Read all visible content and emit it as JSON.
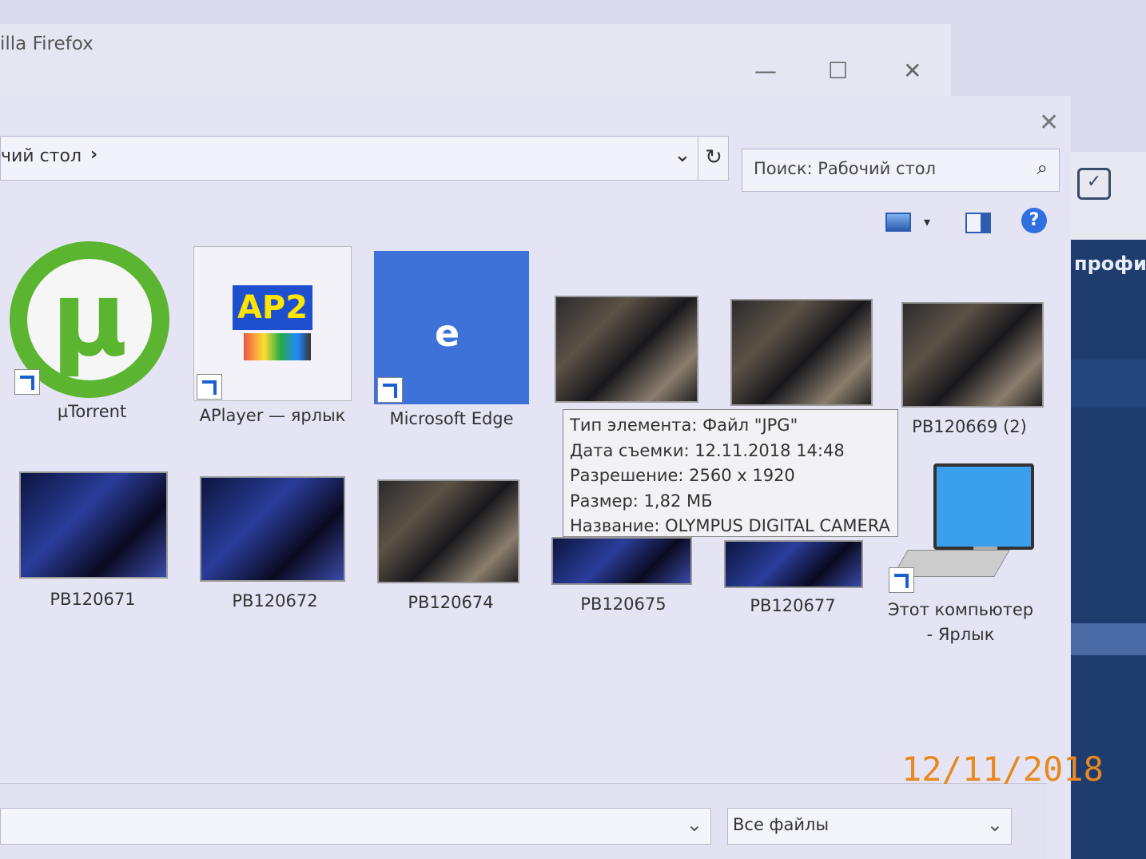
{
  "firefox": {
    "title": "illa Firefox",
    "minimize": "—",
    "maximize": "☐",
    "close": "✕"
  },
  "dialog": {
    "close": "✕",
    "breadcrumb": "чий стол",
    "breadcrumb_arrow": "›",
    "dropdown": "⌄",
    "refresh": "↻",
    "search_placeholder": "Поиск: Рабочий стол",
    "search_icon": "⌕",
    "help": "?"
  },
  "side_panel": {
    "label": "профи"
  },
  "items": [
    {
      "label": "µTorrent"
    },
    {
      "label": "APlayer — ярлык",
      "logo": "AP2"
    },
    {
      "label": "Microsoft Edge",
      "logo": "e"
    },
    {
      "label": ""
    },
    {
      "label": ""
    },
    {
      "label": "PB120669 (2)"
    },
    {
      "label": "PB120671"
    },
    {
      "label": "PB120672"
    },
    {
      "label": "PB120674"
    },
    {
      "label": "PB120675"
    },
    {
      "label": "PB120677"
    },
    {
      "label": "Этот компьютер - Ярлык"
    }
  ],
  "tooltip": {
    "type": "Тип элемента: Файл \"JPG\"",
    "date": "Дата съемки: 12.11.2018 14:48",
    "resolution": "Разрешение: 2560 x 1920",
    "size": "Размер: 1,82 МБ",
    "title": "Название: OLYMPUS DIGITAL CAMERA"
  },
  "bottom": {
    "filetype": "Все файлы",
    "chevron": "⌄"
  },
  "datestamp": "12/11/2018"
}
